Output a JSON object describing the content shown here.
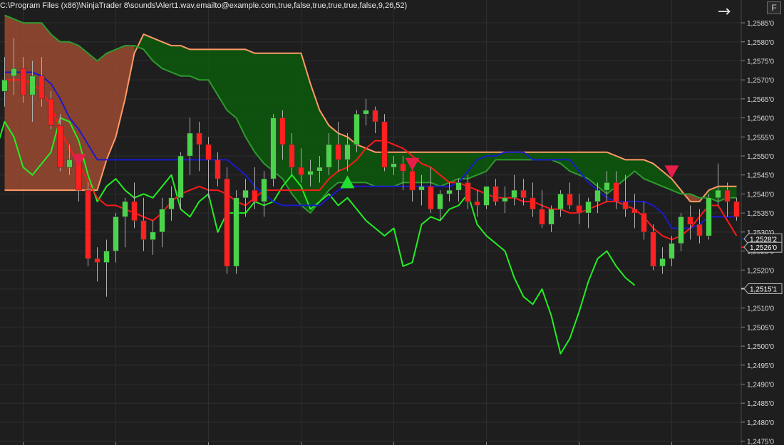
{
  "header": {
    "indicator_text": "C:\\Program Files (x86)\\NinjaTrader 8\\sounds\\Alert1.wav,emailto@example.com,true,false,true,true,true,false,9,26,52)",
    "nav_icon": "arrow-right-icon",
    "f_label": "F"
  },
  "colors": {
    "background": "#1e1e1e",
    "grid": "#2e2e2e",
    "axis_text": "#d8d8d8",
    "up_candle": "#4cd34c",
    "down_candle": "#ff2020",
    "wick": "#b0b0b0",
    "tenkan": "#ff1a1a",
    "kijun": "#1a1acd",
    "chikou": "#22ee22",
    "senkou_a": "#ff9a66",
    "senkou_b": "#2e9a2e",
    "cloud_bull": "#0c5a0c",
    "cloud_bear": "#9a4a30",
    "signal_up": "#22dd33",
    "signal_down": "#e81e4a"
  },
  "chart_data": {
    "type": "candlestick",
    "ylim": [
      1.2474,
      1.2591
    ],
    "x_range": [
      -0.5,
      79.5
    ],
    "grid": true,
    "y_ticks": [
      "1,2585'0",
      "1,2580'0",
      "1,2575'0",
      "1,2570'0",
      "1,2565'0",
      "1,2560'0",
      "1,2555'0",
      "1,2550'0",
      "1,2545'0",
      "1,2540'0",
      "1,2535'0",
      "1,2530'0",
      "1,2525'0",
      "1,2520'0",
      "1,2515'0",
      "1,2510'0",
      "1,2505'0",
      "1,2500'0",
      "1,2495'0",
      "1,2490'0",
      "1,2485'0",
      "1,2480'0",
      "1,2475'0"
    ],
    "y_tick_values": [
      1.2585,
      1.258,
      1.2575,
      1.257,
      1.2565,
      1.256,
      1.2555,
      1.255,
      1.2545,
      1.254,
      1.2535,
      1.253,
      1.2525,
      1.252,
      1.2515,
      1.251,
      1.2505,
      1.25,
      1.2495,
      1.249,
      1.2485,
      1.248,
      1.2475
    ],
    "price_tags": [
      {
        "label": "1,2528'2",
        "value": 1.25282,
        "color": "#1a1acd"
      },
      {
        "label": "1,2526'0",
        "value": 1.2526,
        "color": "#ff1a1a"
      },
      {
        "label": "1,2515'1",
        "value": 1.25151,
        "color": "#cccccc"
      }
    ],
    "candles": [
      [
        1.2567,
        1.2576,
        1.2563,
        1.257
      ],
      [
        1.2571,
        1.2581,
        1.2566,
        1.2573
      ],
      [
        1.2573,
        1.2576,
        1.2564,
        1.2566
      ],
      [
        1.2566,
        1.2575,
        1.2559,
        1.2571
      ],
      [
        1.2571,
        1.2576,
        1.2563,
        1.2565
      ],
      [
        1.2565,
        1.2567,
        1.2557,
        1.2558
      ],
      [
        1.2558,
        1.2561,
        1.2546,
        1.2547
      ],
      [
        1.2547,
        1.2553,
        1.2545,
        1.2549
      ],
      [
        1.2549,
        1.255,
        1.2538,
        1.2541
      ],
      [
        1.2541,
        1.2543,
        1.2521,
        1.2523
      ],
      [
        1.2523,
        1.2526,
        1.2517,
        1.2522
      ],
      [
        1.2522,
        1.2528,
        1.2513,
        1.2525
      ],
      [
        1.2525,
        1.2535,
        1.2522,
        1.2534
      ],
      [
        1.2534,
        1.2539,
        1.2526,
        1.2538
      ],
      [
        1.2538,
        1.2543,
        1.2531,
        1.2533
      ],
      [
        1.2533,
        1.2539,
        1.2525,
        1.2528
      ],
      [
        1.2528,
        1.2533,
        1.2524,
        1.253
      ],
      [
        1.253,
        1.2539,
        1.2526,
        1.2536
      ],
      [
        1.2536,
        1.2542,
        1.2533,
        1.2539
      ],
      [
        1.2539,
        1.2551,
        1.2536,
        1.255
      ],
      [
        1.255,
        1.256,
        1.2545,
        1.2556
      ],
      [
        1.2556,
        1.2559,
        1.2546,
        1.2553
      ],
      [
        1.2553,
        1.2555,
        1.2539,
        1.2549
      ],
      [
        1.2549,
        1.2551,
        1.2542,
        1.2544
      ],
      [
        1.2544,
        1.2547,
        1.2519,
        1.2521
      ],
      [
        1.2521,
        1.2541,
        1.2519,
        1.2539
      ],
      [
        1.2539,
        1.2544,
        1.2534,
        1.2541
      ],
      [
        1.2541,
        1.2547,
        1.2536,
        1.2538
      ],
      [
        1.2538,
        1.2546,
        1.2534,
        1.2544
      ],
      [
        1.2544,
        1.2561,
        1.2542,
        1.256
      ],
      [
        1.256,
        1.2562,
        1.2549,
        1.2553
      ],
      [
        1.2553,
        1.2556,
        1.2545,
        1.2547
      ],
      [
        1.2547,
        1.2552,
        1.2543,
        1.2545
      ],
      [
        1.2545,
        1.2549,
        1.2542,
        1.2546
      ],
      [
        1.2546,
        1.255,
        1.2543,
        1.2547
      ],
      [
        1.2547,
        1.2556,
        1.2545,
        1.2553
      ],
      [
        1.2553,
        1.2559,
        1.2546,
        1.2549
      ],
      [
        1.2549,
        1.2556,
        1.2546,
        1.2553
      ],
      [
        1.2553,
        1.2562,
        1.2551,
        1.2561
      ],
      [
        1.2561,
        1.2565,
        1.2558,
        1.2562
      ],
      [
        1.2562,
        1.2563,
        1.2556,
        1.2559
      ],
      [
        1.2559,
        1.2561,
        1.2546,
        1.2547
      ],
      [
        1.2547,
        1.255,
        1.2545,
        1.2548
      ],
      [
        1.2548,
        1.255,
        1.2541,
        1.2546
      ],
      [
        1.2546,
        1.2547,
        1.2538,
        1.2541
      ],
      [
        1.2541,
        1.2545,
        1.2537,
        1.2542
      ],
      [
        1.2542,
        1.2547,
        1.2535,
        1.2536
      ],
      [
        1.2536,
        1.2541,
        1.2533,
        1.254
      ],
      [
        1.254,
        1.2543,
        1.2538,
        1.2541
      ],
      [
        1.2541,
        1.2544,
        1.2538,
        1.2543
      ],
      [
        1.2543,
        1.2545,
        1.2536,
        1.2538
      ],
      [
        1.2538,
        1.2541,
        1.2534,
        1.2537
      ],
      [
        1.2537,
        1.2542,
        1.2536,
        1.2542
      ],
      [
        1.2542,
        1.2544,
        1.2537,
        1.2538
      ],
      [
        1.2538,
        1.2542,
        1.2535,
        1.2539
      ],
      [
        1.2539,
        1.2545,
        1.2537,
        1.2541
      ],
      [
        1.2541,
        1.2544,
        1.2537,
        1.2539
      ],
      [
        1.2539,
        1.2543,
        1.2534,
        1.2536
      ],
      [
        1.2536,
        1.2541,
        1.2531,
        1.2532
      ],
      [
        1.2532,
        1.2537,
        1.253,
        1.2536
      ],
      [
        1.2536,
        1.2541,
        1.2534,
        1.254
      ],
      [
        1.254,
        1.2543,
        1.2536,
        1.2537
      ],
      [
        1.2537,
        1.254,
        1.2532,
        1.2535
      ],
      [
        1.2535,
        1.2539,
        1.2531,
        1.2538
      ],
      [
        1.2538,
        1.2543,
        1.2535,
        1.2541
      ],
      [
        1.2541,
        1.2546,
        1.2538,
        1.2543
      ],
      [
        1.2543,
        1.2546,
        1.2536,
        1.2538
      ],
      [
        1.2538,
        1.2545,
        1.2534,
        1.2536
      ],
      [
        1.2536,
        1.254,
        1.2531,
        1.2535
      ],
      [
        1.2535,
        1.2538,
        1.2528,
        1.253
      ],
      [
        1.253,
        1.2532,
        1.252,
        1.2521
      ],
      [
        1.2521,
        1.2526,
        1.2519,
        1.2523
      ],
      [
        1.2523,
        1.2529,
        1.2521,
        1.2527
      ],
      [
        1.2527,
        1.2535,
        1.2525,
        1.2534
      ],
      [
        1.2534,
        1.2537,
        1.2528,
        1.2532
      ],
      [
        1.2532,
        1.2536,
        1.2527,
        1.2529
      ],
      [
        1.2529,
        1.254,
        1.2528,
        1.2539
      ],
      [
        1.2539,
        1.2548,
        1.2537,
        1.2541
      ],
      [
        1.2541,
        1.2543,
        1.2534,
        1.2538
      ],
      [
        1.2538,
        1.2539,
        1.2533,
        1.2534
      ]
    ],
    "tenkan": [
      1.257,
      1.257,
      1.257,
      1.2569,
      1.2567,
      1.2563,
      1.2557,
      1.2552,
      1.2548,
      1.2543,
      1.2539,
      1.2537,
      1.2537,
      1.2536,
      1.2535,
      1.2534,
      1.2533,
      1.2535,
      1.2538,
      1.254,
      1.2541,
      1.2542,
      1.2541,
      1.2541,
      1.254,
      1.2538,
      1.2537,
      1.2539,
      1.2541,
      1.2541,
      1.2541,
      1.2541,
      1.2541,
      1.2541,
      1.2541,
      1.2544,
      1.2546,
      1.2547,
      1.2549,
      1.2552,
      1.2554,
      1.2554,
      1.2553,
      1.2552,
      1.255,
      1.2548,
      1.2547,
      1.2545,
      1.2543,
      1.2543,
      1.2542,
      1.2541,
      1.254,
      1.2539,
      1.2539,
      1.2539,
      1.2538,
      1.2538,
      1.2537,
      1.2536,
      1.2536,
      1.2535,
      1.2535,
      1.2536,
      1.2537,
      1.2538,
      1.2538,
      1.2537,
      1.2536,
      1.2534,
      1.2531,
      1.2529,
      1.2528,
      1.2529,
      1.2531,
      1.2534,
      1.2537,
      1.2537,
      1.2533,
      1.2529
    ],
    "kijun": [
      1.2572,
      1.2572,
      1.2572,
      1.2572,
      1.2571,
      1.2569,
      1.2565,
      1.256,
      1.2557,
      1.2553,
      1.2549,
      1.2549,
      1.2549,
      1.2549,
      1.2549,
      1.2549,
      1.2549,
      1.2549,
      1.2549,
      1.2549,
      1.2549,
      1.2549,
      1.2549,
      1.2549,
      1.2549,
      1.2547,
      1.2545,
      1.2542,
      1.254,
      1.2538,
      1.2537,
      1.2537,
      1.2537,
      1.2537,
      1.2537,
      1.2539,
      1.2541,
      1.2542,
      1.2542,
      1.2542,
      1.2542,
      1.2542,
      1.2542,
      1.2542,
      1.2542,
      1.2542,
      1.2542,
      1.2542,
      1.2542,
      1.2543,
      1.2546,
      1.2549,
      1.255,
      1.255,
      1.2551,
      1.2551,
      1.2551,
      1.2549,
      1.2549,
      1.2549,
      1.2549,
      1.2549,
      1.2546,
      1.2543,
      1.2541,
      1.2539,
      1.2538,
      1.2538,
      1.2538,
      1.2538,
      1.2537,
      1.2535,
      1.2531,
      1.2531,
      1.2531,
      1.2532,
      1.2534,
      1.2534,
      1.2534,
      1.2534
    ],
    "chikou": [
      1.2536,
      1.2543,
      1.2547,
      1.2551,
      1.2559,
      1.2555,
      1.2547,
      1.2545,
      1.2548,
      1.2551,
      1.256,
      1.2559,
      1.2554,
      1.2545,
      1.2538,
      1.2542,
      1.2544,
      1.2541,
      1.2539,
      1.254,
      1.2539,
      1.2542,
      1.2545,
      1.2536,
      1.2534,
      1.2538,
      1.254,
      1.253,
      1.2535,
      1.2535,
      1.2535,
      1.2538,
      1.2537,
      1.2538,
      1.2542,
      1.2545,
      1.2542,
      1.2536,
      1.2538,
      1.254,
      1.2537,
      1.2539,
      1.2536,
      1.2533,
      1.2531,
      1.2529,
      1.2531,
      1.2521,
      1.2522,
      1.2532,
      1.2534,
      1.2533,
      1.2536,
      1.2537,
      1.254,
      1.2532,
      1.2529,
      1.2527,
      1.2525,
      1.2518,
      1.2513,
      1.2511,
      1.2515,
      1.2508,
      1.2498,
      1.2502,
      1.2509,
      1.2517,
      1.2523,
      1.2525,
      1.2521,
      1.2518,
      1.2516
    ],
    "chikou_start": -4,
    "senkou_a": [
      1.2541,
      1.2541,
      1.2541,
      1.2541,
      1.2541,
      1.2541,
      1.2541,
      1.2541,
      1.2541,
      1.2541,
      1.2541,
      1.2549,
      1.2555,
      1.2565,
      1.2577,
      1.2582,
      1.2581,
      1.258,
      1.2579,
      1.2579,
      1.2578,
      1.2578,
      1.2578,
      1.2578,
      1.2578,
      1.2578,
      1.2578,
      1.2577,
      1.2577,
      1.2577,
      1.2577,
      1.2577,
      1.2577,
      1.2569,
      1.2562,
      1.2558,
      1.2556,
      1.2555,
      1.2553,
      1.2552,
      1.2551,
      1.2551,
      1.2551,
      1.2551,
      1.2551,
      1.2551,
      1.2551,
      1.2551,
      1.2551,
      1.2551,
      1.2551,
      1.2551,
      1.2551,
      1.2551,
      1.2551,
      1.2551,
      1.2551,
      1.2551,
      1.2551,
      1.2551,
      1.2551,
      1.2551,
      1.2551,
      1.2551,
      1.2551,
      1.2551,
      1.255,
      1.2549,
      1.2549,
      1.2549,
      1.2548,
      1.2546,
      1.2544,
      1.2541,
      1.2538,
      1.2538,
      1.2541,
      1.2542,
      1.2542,
      1.2542
    ],
    "senkou_b": [
      1.2587,
      1.2586,
      1.2585,
      1.2585,
      1.2585,
      1.2582,
      1.258,
      1.258,
      1.2579,
      1.2577,
      1.2575,
      1.2577,
      1.2578,
      1.2579,
      1.2579,
      1.2578,
      1.2575,
      1.2573,
      1.2572,
      1.2571,
      1.2571,
      1.257,
      1.257,
      1.2566,
      1.2562,
      1.256,
      1.2555,
      1.2551,
      1.2548,
      1.2546,
      1.2544,
      1.254,
      1.2537,
      1.2535,
      1.2538,
      1.2541,
      1.2543,
      1.2543,
      1.2543,
      1.2543,
      1.2542,
      1.2542,
      1.2542,
      1.2543,
      1.2543,
      1.2543,
      1.2543,
      1.2542,
      1.2543,
      1.2544,
      1.2544,
      1.2545,
      1.2546,
      1.2549,
      1.2549,
      1.2549,
      1.2549,
      1.2549,
      1.2549,
      1.2549,
      1.2548,
      1.2546,
      1.2545,
      1.2544,
      1.2542,
      1.254,
      1.2542,
      1.2544,
      1.2546,
      1.2544,
      1.2543,
      1.2542,
      1.2541,
      1.254,
      1.254,
      1.2539,
      1.2539,
      1.2538,
      1.2539,
      1.2539
    ],
    "signals": [
      {
        "dir": "down",
        "index": 8,
        "price": 1.2549
      },
      {
        "dir": "up",
        "index": 37,
        "price": 1.2543
      },
      {
        "dir": "down",
        "index": 44,
        "price": 1.2548
      },
      {
        "dir": "down",
        "index": 72,
        "price": 1.2546
      }
    ]
  }
}
